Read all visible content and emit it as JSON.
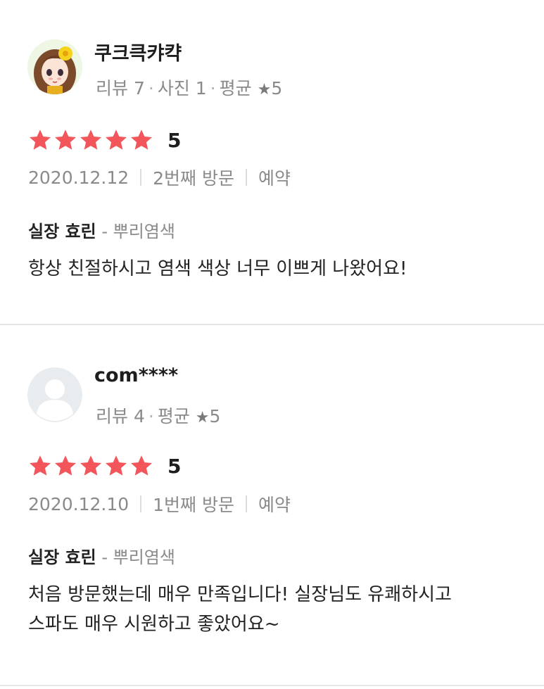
{
  "reviews": [
    {
      "username": "쿠크큭캬캭",
      "stats": {
        "reviews": "리뷰 7",
        "photos": "사진 1",
        "avg_label": "평균",
        "avg_star": "★",
        "avg_value": "5"
      },
      "rating": {
        "stars": 5,
        "value": "5",
        "star_color": "#f2565b"
      },
      "date": "2020.12.12",
      "visit": "2번째 방문",
      "booking": "예약",
      "stylist": "실장 효린",
      "service": "- 뿌리염색",
      "text_lines": [
        "항상 친절하시고 염색 색상 너무 이쁘게 나왔어요!"
      ],
      "avatar_icon": "character-avatar-icon"
    },
    {
      "username": "com****",
      "stats": {
        "reviews": "리뷰 4",
        "avg_label": "평균",
        "avg_star": "★",
        "avg_value": "5"
      },
      "rating": {
        "stars": 5,
        "value": "5",
        "star_color": "#f2565b"
      },
      "date": "2020.12.10",
      "visit": "1번째 방문",
      "booking": "예약",
      "stylist": "실장 효린",
      "service": "- 뿌리염색",
      "text_lines": [
        "처음 방문했는데 매우 만족입니다! 실장님도 유쾌하시고",
        "스파도 매우 시원하고 좋았어요~"
      ],
      "avatar_icon": "default-user-avatar-icon"
    }
  ],
  "colors": {
    "star": "#f2565b",
    "muted": "#8a8a8a",
    "divider": "#e6e6e6"
  }
}
